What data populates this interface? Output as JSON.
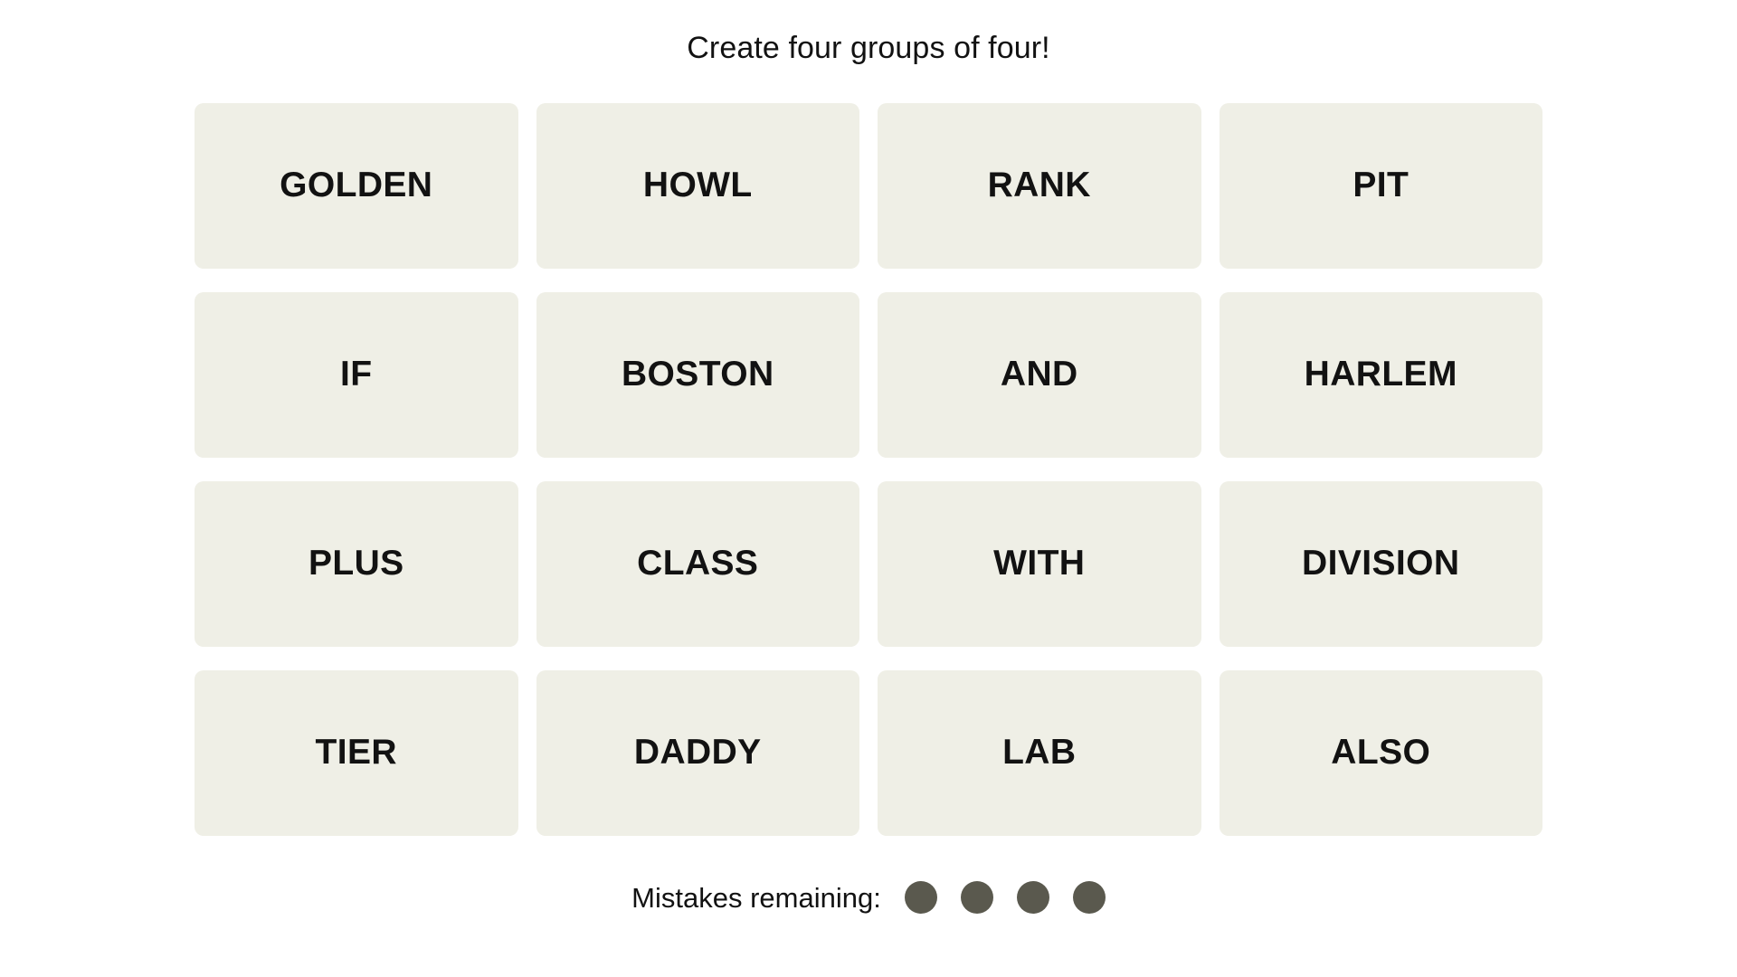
{
  "page": {
    "background_color": "#ffffff",
    "title": "Create four groups of four!"
  },
  "grid": {
    "rows": [
      [
        "GOLDEN",
        "HOWL",
        "RANK",
        "PIT"
      ],
      [
        "IF",
        "BOSTON",
        "AND",
        "HARLEM"
      ],
      [
        "PLUS",
        "CLASS",
        "WITH",
        "DIVISION"
      ],
      [
        "TIER",
        "DADDY",
        "LAB",
        "ALSO"
      ]
    ],
    "tile_background_color": "#efefe6",
    "tile_text_color": "#121212",
    "tiles": [
      {
        "label": "GOLDEN",
        "row": 1,
        "col": 1
      },
      {
        "label": "HOWL",
        "row": 1,
        "col": 2
      },
      {
        "label": "RANK",
        "row": 1,
        "col": 3
      },
      {
        "label": "PIT",
        "row": 1,
        "col": 4
      },
      {
        "label": "IF",
        "row": 2,
        "col": 1
      },
      {
        "label": "BOSTON",
        "row": 2,
        "col": 2
      },
      {
        "label": "AND",
        "row": 2,
        "col": 3
      },
      {
        "label": "HARLEM",
        "row": 2,
        "col": 4
      },
      {
        "label": "PLUS",
        "row": 3,
        "col": 1
      },
      {
        "label": "CLASS",
        "row": 3,
        "col": 2
      },
      {
        "label": "WITH",
        "row": 3,
        "col": 3
      },
      {
        "label": "DIVISION",
        "row": 3,
        "col": 4
      },
      {
        "label": "TIER",
        "row": 4,
        "col": 1
      },
      {
        "label": "DADDY",
        "row": 4,
        "col": 2
      },
      {
        "label": "LAB",
        "row": 4,
        "col": 3
      },
      {
        "label": "ALSO",
        "row": 4,
        "col": 4
      }
    ]
  },
  "mistakes": {
    "label": "Mistakes remaining:",
    "remaining": 4,
    "dot_color": "#5a594e",
    "dots": [
      "dot-1",
      "dot-2",
      "dot-3",
      "dot-4"
    ]
  }
}
